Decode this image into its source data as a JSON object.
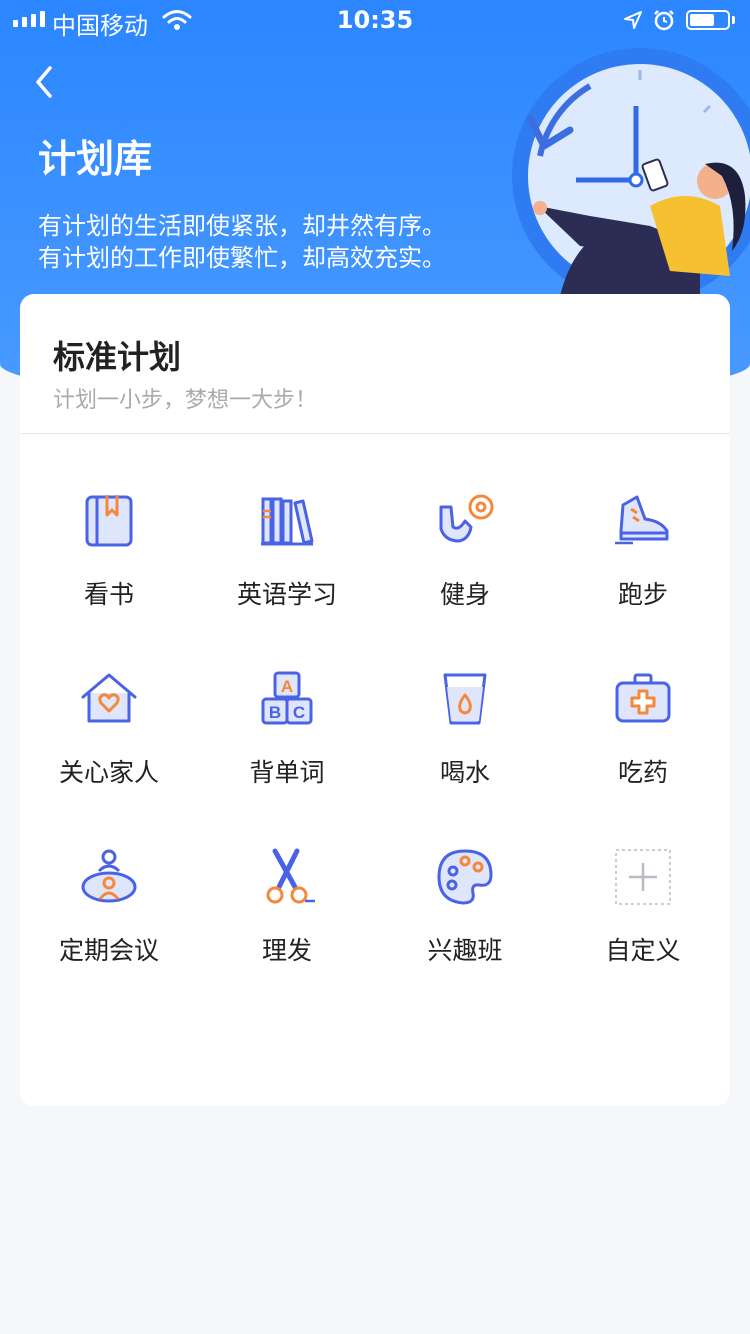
{
  "status_bar": {
    "carrier": "中国移动",
    "time": "10:35"
  },
  "header": {
    "title": "计划库",
    "slogan_line1": "有计划的生活即使紧张，却井然有序。",
    "slogan_line2": "有计划的工作即使繁忙，却高效充实。"
  },
  "card": {
    "title": "标准计划",
    "subtitle": "计划一小步，梦想一大步！",
    "items": [
      {
        "label": "看书",
        "icon": "book-icon"
      },
      {
        "label": "英语学习",
        "icon": "books-shelf-icon"
      },
      {
        "label": "健身",
        "icon": "fitness-icon"
      },
      {
        "label": "跑步",
        "icon": "running-shoe-icon"
      },
      {
        "label": "关心家人",
        "icon": "house-heart-icon"
      },
      {
        "label": "背单词",
        "icon": "abc-blocks-icon"
      },
      {
        "label": "喝水",
        "icon": "water-cup-icon"
      },
      {
        "label": "吃药",
        "icon": "medicine-kit-icon"
      },
      {
        "label": "定期会议",
        "icon": "meeting-icon"
      },
      {
        "label": "理发",
        "icon": "scissors-icon"
      },
      {
        "label": "兴趣班",
        "icon": "palette-icon"
      },
      {
        "label": "自定义",
        "icon": "add-icon"
      }
    ]
  },
  "colors": {
    "primary": "#2b86ff",
    "icon_blue": "#4a63e6",
    "icon_orange": "#f5883a"
  }
}
